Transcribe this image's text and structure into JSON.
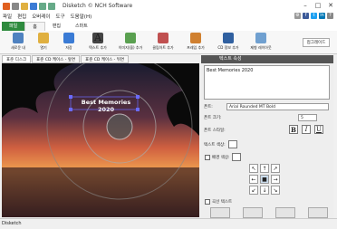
{
  "window": {
    "title": "Disketch © NCH Software",
    "minimize": "–",
    "maximize": "□",
    "close": "✕"
  },
  "menu": [
    "파일",
    "편집",
    "오버레이",
    "도구",
    "도움말(H)"
  ],
  "tabs": {
    "file": "파일",
    "home": "홈",
    "edit": "편집",
    "skins": "스마트"
  },
  "ribbon": [
    {
      "label": "새로운 내",
      "color": "#4f82c0"
    },
    {
      "label": "열기",
      "color": "#e0b040"
    },
    {
      "label": "저장",
      "color": "#3a7bd5"
    },
    {
      "label": "텍스트 추가",
      "color": "#444444"
    },
    {
      "label": "이미지(을) 추가",
      "color": "#5aa050"
    },
    {
      "label": "클립아트 추가",
      "color": "#c05050"
    },
    {
      "label": "프레임 추가",
      "color": "#d08030"
    },
    {
      "label": "CD 정보 추가",
      "color": "#3060a0"
    },
    {
      "label": "제형 레이아웃",
      "color": "#70a0d0"
    }
  ],
  "external_help": "접그레이드",
  "subtabs": [
    "표준 디스크",
    "표준 CD 케이스 - 앞면",
    "표준 CD 케이스 - 뒤면"
  ],
  "canvas": {
    "text": "Best Memories 2020"
  },
  "panel": {
    "header": "텍스트 속성",
    "text_value": "Best Memories 2020",
    "font_label": "폰트:",
    "font_value": "Arial Rounded MT Bold",
    "size_label": "폰트 크기:",
    "size_value": "5",
    "style_label": "폰트 스타일:",
    "bold": "B",
    "italic": "I",
    "underline": "U",
    "text_color_label": "텍스트 색상:",
    "bg_color_label": "배경 색상:",
    "shadow_label": "곡선 텍스트",
    "grid": [
      "↖",
      "↑",
      "↗",
      "←",
      "■",
      "→",
      "↙",
      "↓",
      "↘"
    ]
  },
  "status": "Disketch"
}
